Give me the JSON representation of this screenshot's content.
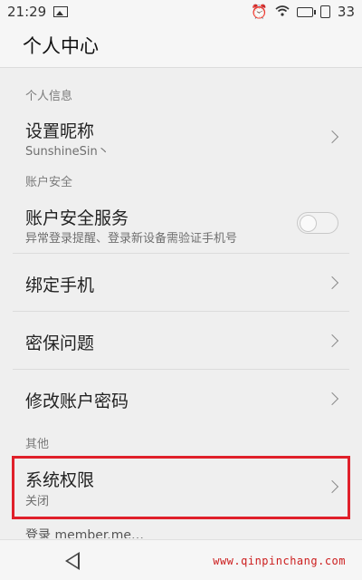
{
  "status_bar": {
    "time": "21:29",
    "battery": "33"
  },
  "header": {
    "title": "个人中心"
  },
  "sections": {
    "personal_info": "个人信息",
    "account_security": "账户安全",
    "other": "其他"
  },
  "rows": {
    "nickname": {
      "label": "设置昵称",
      "value": "SunshineSin丶"
    },
    "security_service": {
      "label": "账户安全服务",
      "desc": "异常登录提醒、登录新设备需验证手机号",
      "enabled": false
    },
    "bind_phone": {
      "label": "绑定手机"
    },
    "security_question": {
      "label": "密保问题"
    },
    "change_password": {
      "label": "修改账户密码"
    },
    "system_permission": {
      "label": "系统权限",
      "value": "关闭"
    }
  },
  "partial_row": {
    "label": "登录 member.me…"
  },
  "watermark": "www.qinpinchang.com",
  "colors": {
    "highlight": "#e0202a",
    "background": "#efefef"
  }
}
